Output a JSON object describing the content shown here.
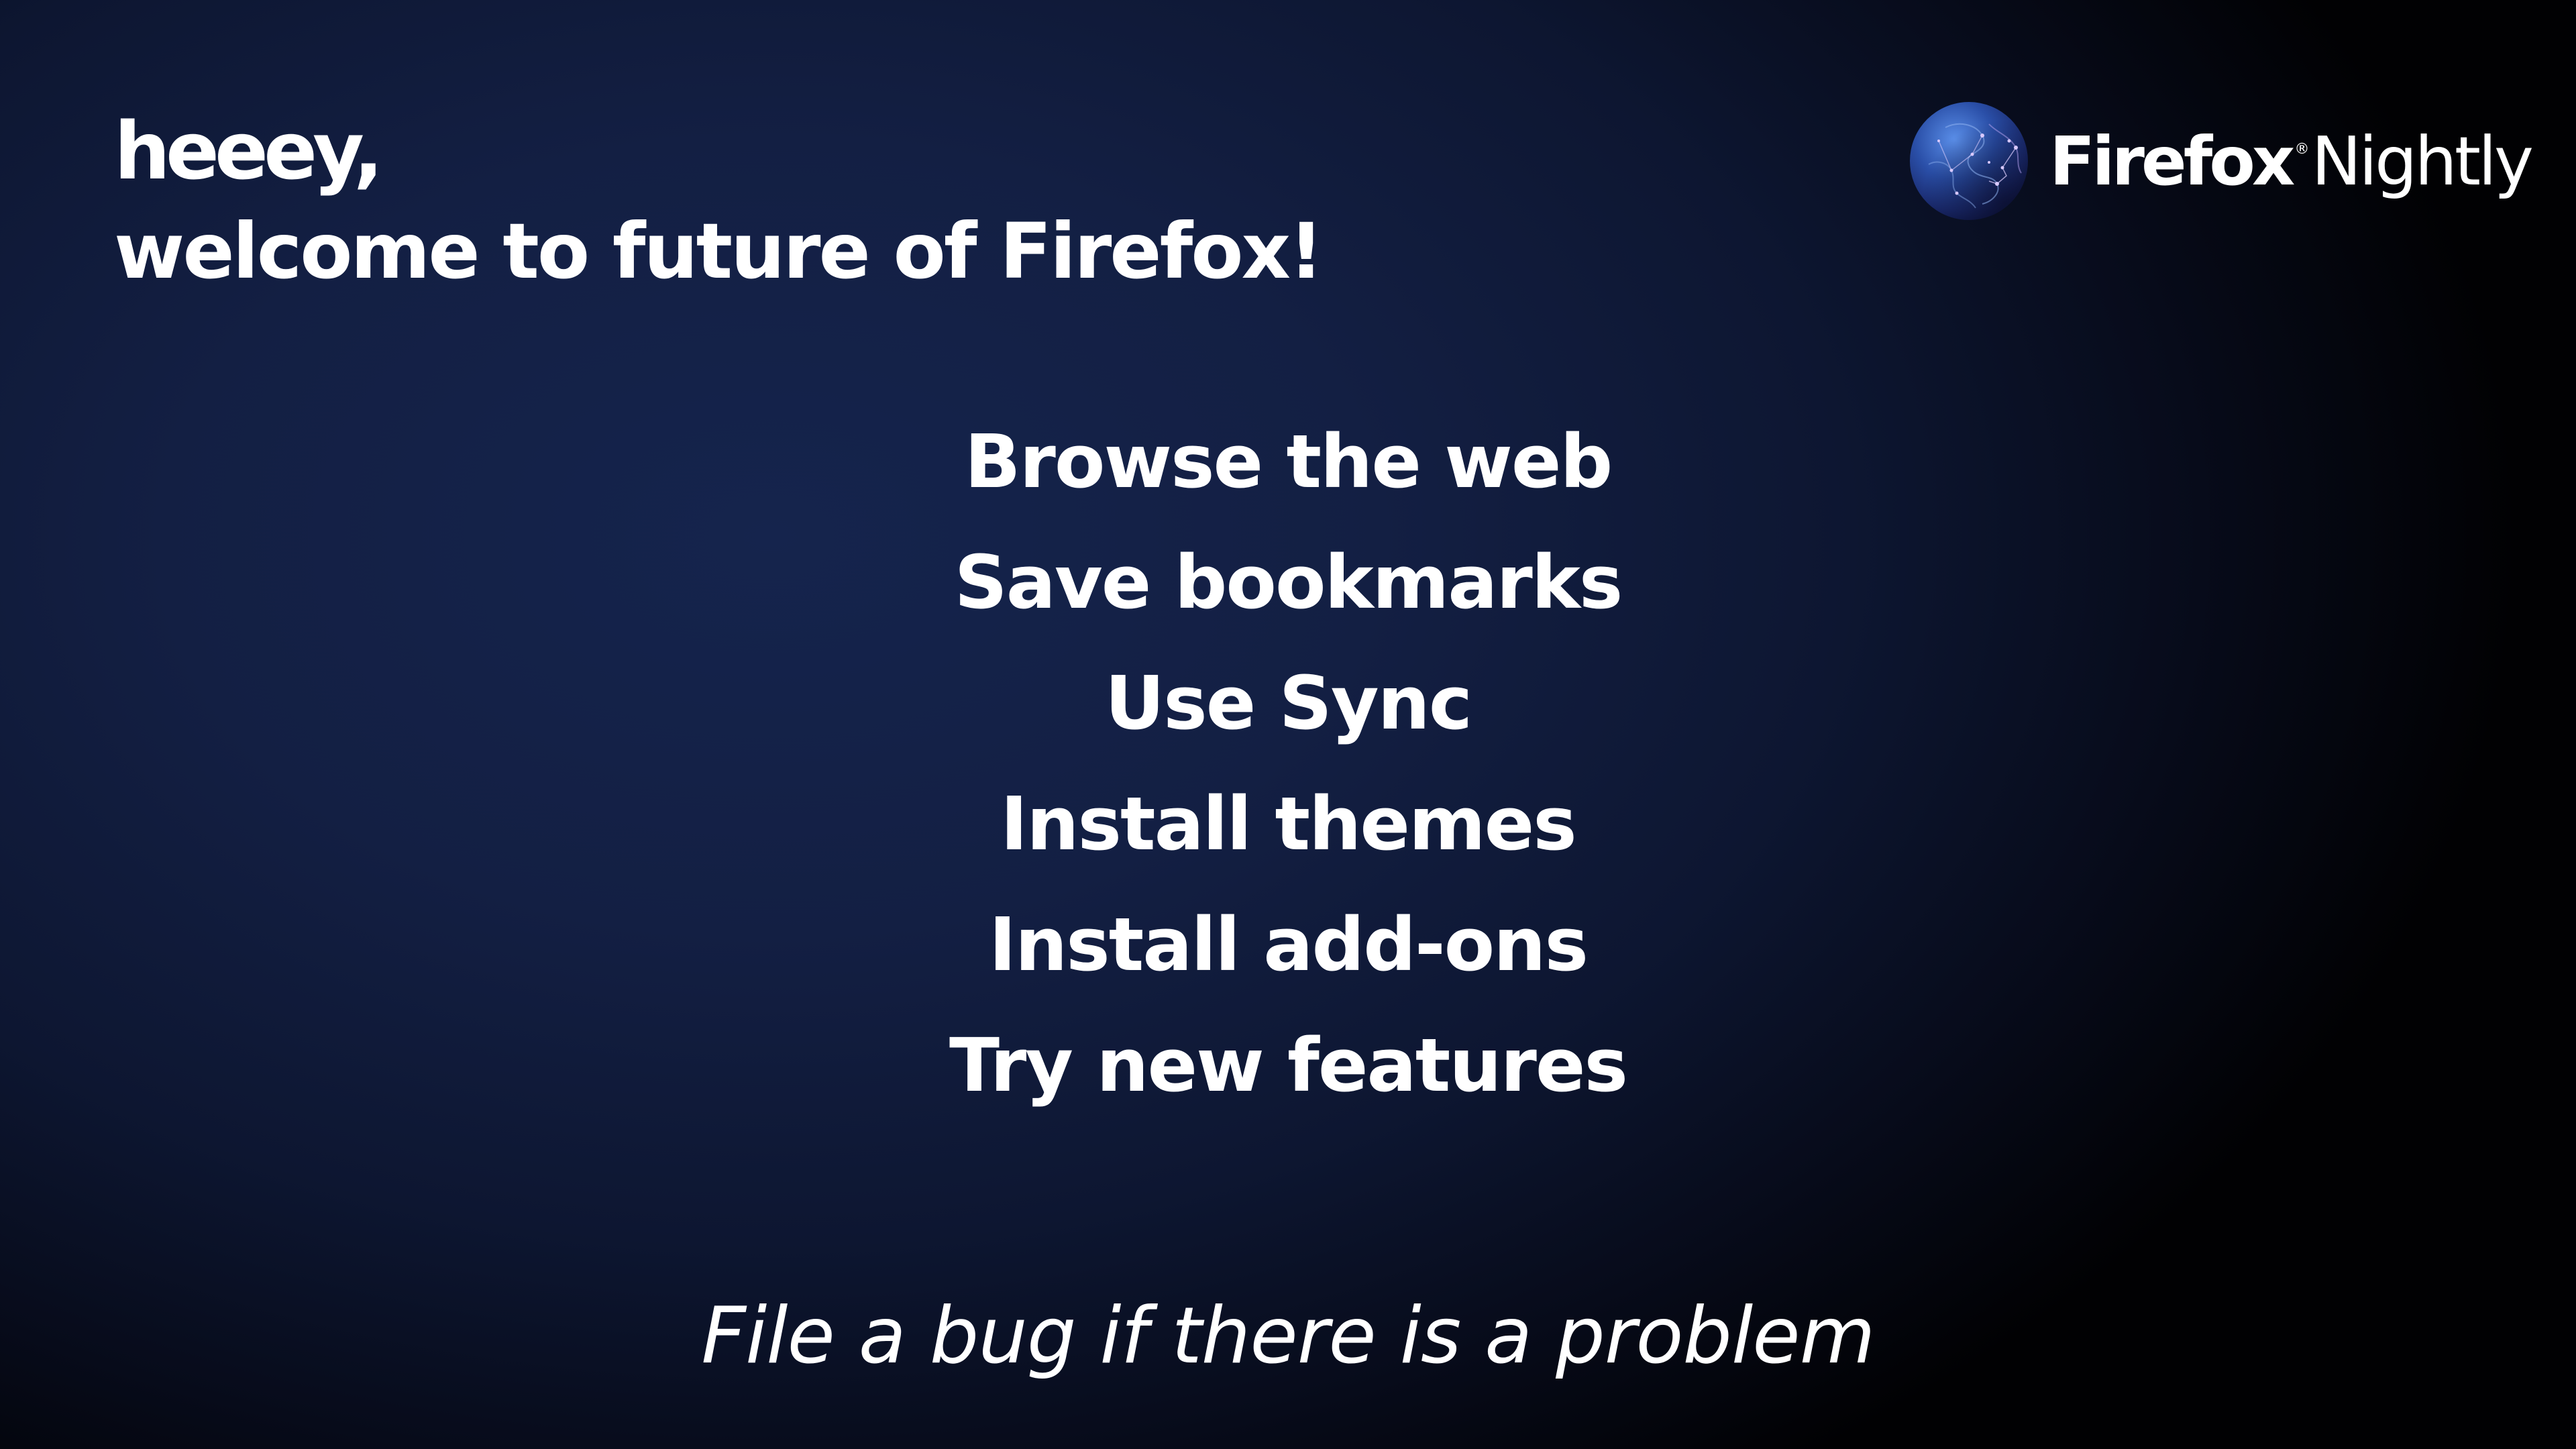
{
  "greeting": {
    "line1": "heeey,",
    "line2": "welcome to future of Firefox!"
  },
  "brand": {
    "logo_icon": "firefox-nightly-globe-icon",
    "name_bold": "Firefox",
    "trademark": "®",
    "name_light": "Nightly"
  },
  "features": {
    "items": [
      "Browse the web",
      "Save bookmarks",
      "Use Sync",
      "Install themes",
      "Install add-ons",
      "Try new features"
    ]
  },
  "footer": {
    "note": "File a bug if there is a problem"
  },
  "colors": {
    "background_center": "#15244d",
    "background_corner": "#010103",
    "text": "#ffffff"
  }
}
